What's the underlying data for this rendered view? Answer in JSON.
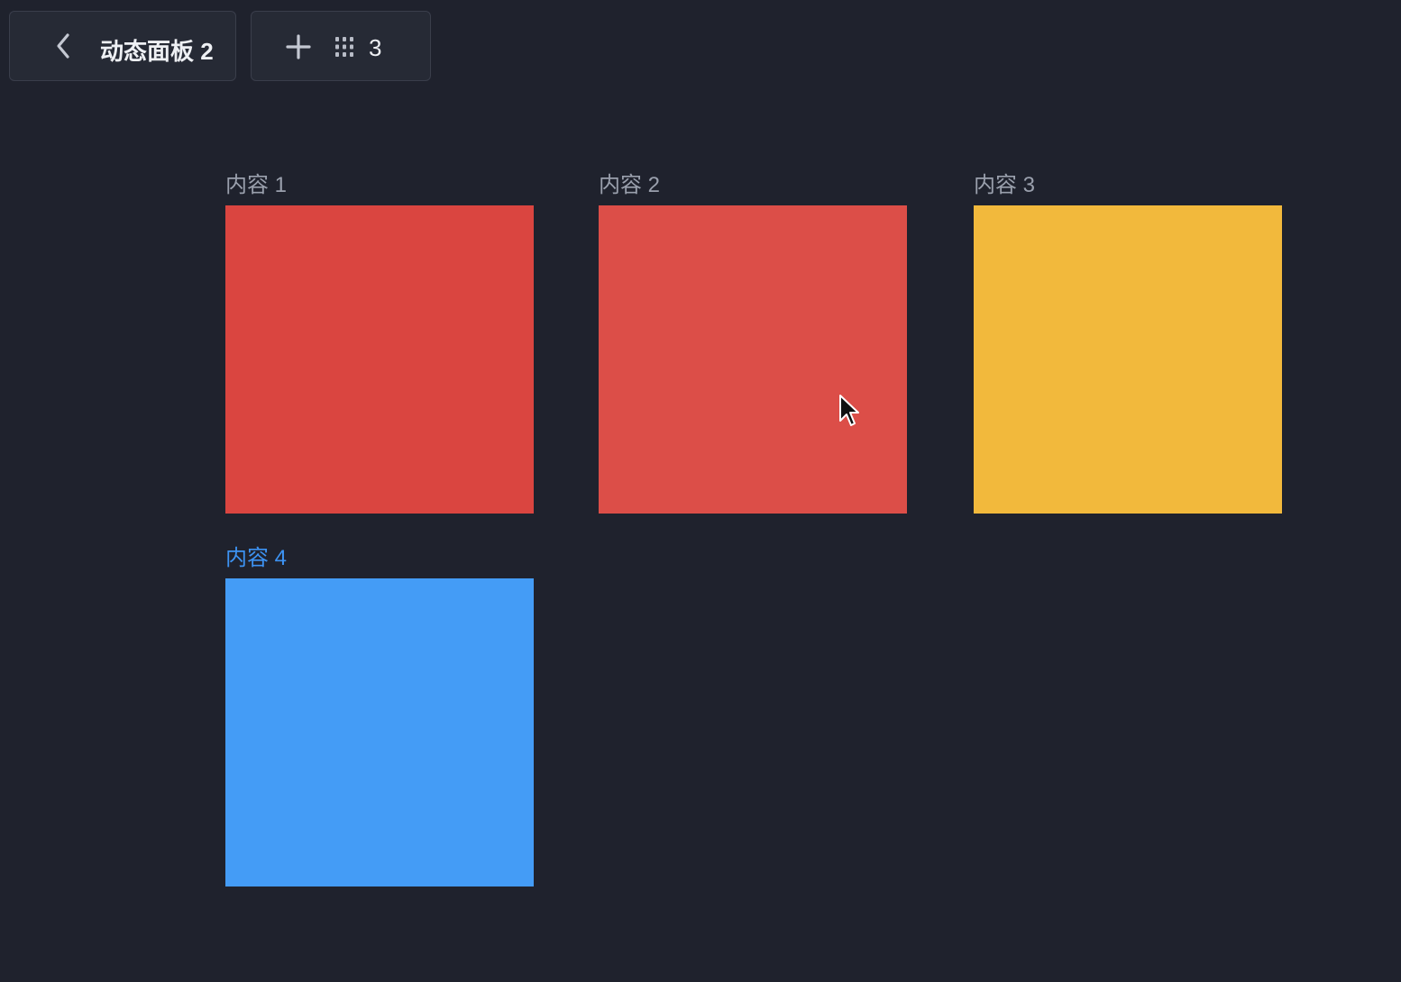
{
  "toolbar": {
    "back_icon": "chevron-left-icon",
    "title": "动态面板 2",
    "add_icon": "plus-icon",
    "panels_icon": "grid-dots-icon",
    "panel_count": "3"
  },
  "panels": [
    {
      "label": "内容 1",
      "color": "#da4540",
      "active": false
    },
    {
      "label": "内容 2",
      "color": "#dc4e48",
      "active": false
    },
    {
      "label": "内容 3",
      "color": "#f2b93c",
      "active": false
    },
    {
      "label": "内容 4",
      "color": "#449cf6",
      "active": true
    }
  ],
  "colors": {
    "background": "#1f222d",
    "active_label": "#3d93f3",
    "inactive_label": "#9aa0ad"
  }
}
